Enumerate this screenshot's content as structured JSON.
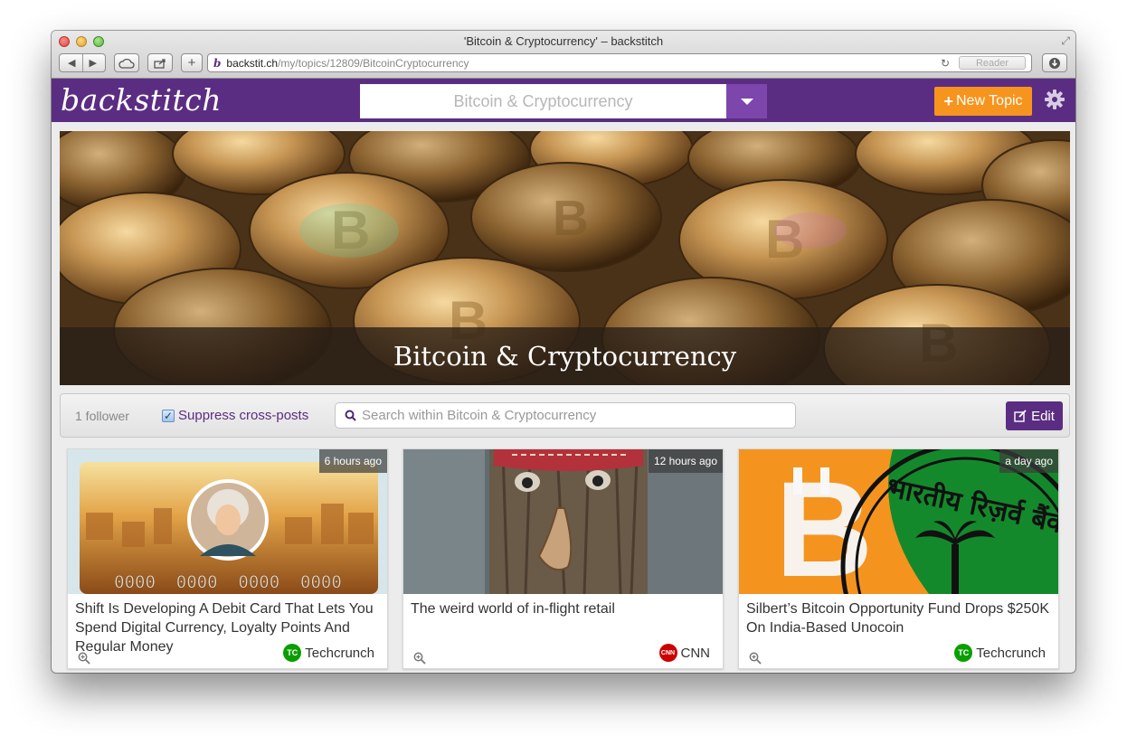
{
  "window": {
    "title": "'Bitcoin & Cryptocurrency' – backstitch"
  },
  "browser": {
    "url_host": "backstit.ch",
    "url_path": "/my/topics/12809/BitcoinCryptocurrency",
    "reader_label": "Reader"
  },
  "header": {
    "logo": "backstitch",
    "topic_selected": "Bitcoin & Cryptocurrency",
    "new_topic_label": "New Topic"
  },
  "hero": {
    "title": "Bitcoin & Cryptocurrency"
  },
  "filter": {
    "followers": "1 follower",
    "suppress_label": "Suppress cross-posts",
    "suppress_checked": true,
    "search_placeholder": "Search within Bitcoin & Cryptocurrency",
    "edit_label": "Edit"
  },
  "cards": [
    {
      "time": "6 hours ago",
      "title": "Shift Is Developing A Debit Card That Lets You Spend Digital Currency, Loyalty Points And Regular Money",
      "source": "Techcrunch",
      "source_logo": "TC",
      "card_digits": "0000  0000  0000  0000"
    },
    {
      "time": "12 hours ago",
      "title": "The weird world of in-flight retail",
      "source": "CNN",
      "source_logo": "CNN"
    },
    {
      "time": "a day ago",
      "title": "Silbert’s Bitcoin Opportunity Fund Drops $250K On India-Based Unocoin",
      "source": "Techcrunch",
      "source_logo": "TC",
      "seal_text": "भारतीय रिज़र्व बैंक"
    }
  ],
  "colors": {
    "brand_purple": "#5b2d82",
    "accent_orange": "#f7941d"
  }
}
